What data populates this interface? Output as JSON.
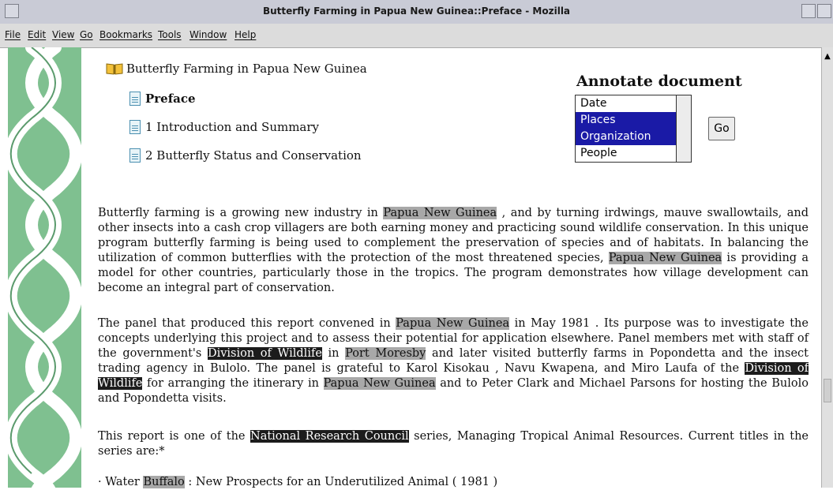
{
  "window": {
    "title": "Butterfly Farming in Papua New Guinea::Preface - Mozilla"
  },
  "menu": [
    "File",
    "Edit",
    "View",
    "Go",
    "Bookmarks",
    "Tools",
    "Window",
    "Help"
  ],
  "tree": {
    "book": "Butterfly Farming in Papua New Guinea",
    "items": [
      "Preface",
      "1 Introduction and Summary",
      "2 Butterfly Status and Conservation"
    ]
  },
  "annotate": {
    "title": "Annotate document",
    "options": [
      "Date",
      "Places",
      "Organization",
      "People"
    ],
    "selected": [
      "Places",
      "Organization"
    ],
    "go_label": "Go"
  },
  "body": {
    "p1": [
      "Butterfly farming is a growing new industry in ",
      "Papua New Guinea",
      " , and by turning irdwings, mauve swallowtails, and other insects into a cash crop villagers are both earning money and practicing sound wildlife conservation. In this unique program butterfly farming is being used to complement the preservation of species and of habitats. In balancing the utilization of common butterflies with the protection of the most threatened species, ",
      "Papua New Guinea",
      " is providing a model for other countries, particularly those in the tropics. The program demonstrates how village development can become an integral part of conservation."
    ],
    "p2": [
      "The panel that produced this report convened in ",
      "Papua New Guinea",
      " in May 1981 . Its purpose was to investigate the concepts underlying this project and to assess their potential for application elsewhere. Panel members met with staff of the government's ",
      "Division of Wildlife",
      " in ",
      "Port Moresby",
      " and later visited butterfly farms in Popondetta and the insect trading agency in Bulolo. The panel is grateful to Karol Kisokau , Navu Kwapena, and Miro Laufa of the ",
      "Division of Wildlife",
      " for arranging the itinerary in ",
      "Papua New Guinea",
      " and to Peter Clark and Michael Parsons for hosting the Bulolo and Popondetta visits."
    ],
    "p3": [
      "This report is one of the ",
      "National Research Council",
      " series, Managing Tropical Animal Resources. Current titles in the series are:*"
    ],
    "p4": [
      "· Water ",
      "Buffalo",
      " : New Prospects for an Underutilized Animal ( 1981 )"
    ]
  },
  "colors": {
    "strip": "#7fc090",
    "selection": "#1a1aa6",
    "highlight_light": "#a8a8a8",
    "highlight_dark": "#1c1c1c"
  },
  "icons": {
    "book": "open-book-icon",
    "doc": "document-icon"
  }
}
